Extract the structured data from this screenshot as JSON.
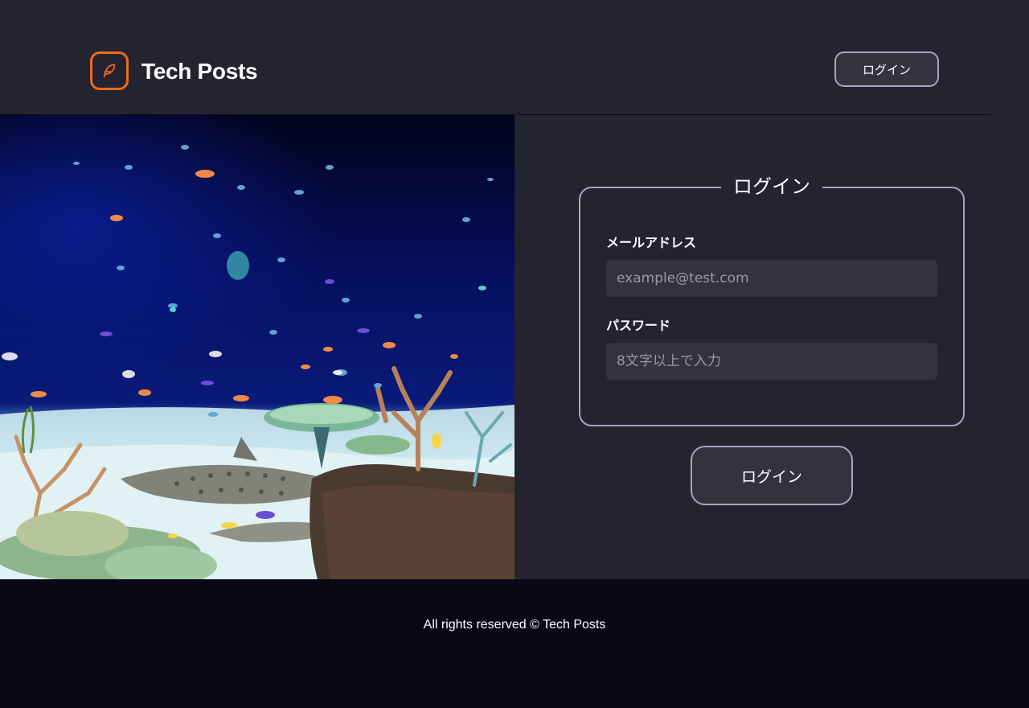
{
  "header": {
    "brand": "Tech Posts",
    "logo_icon": "feather-icon",
    "login_button": "ログイン",
    "accent_color": "#f26b1d"
  },
  "hero": {
    "image": "aquarium-icon"
  },
  "form": {
    "title": "ログイン",
    "email_label": "メールアドレス",
    "email_placeholder": "example@test.com",
    "email_value": "",
    "password_label": "パスワード",
    "password_placeholder": "8文字以上で入力",
    "password_value": "",
    "submit_label": "ログイン"
  },
  "footer": {
    "copyright": "All rights reserved © Tech Posts"
  }
}
